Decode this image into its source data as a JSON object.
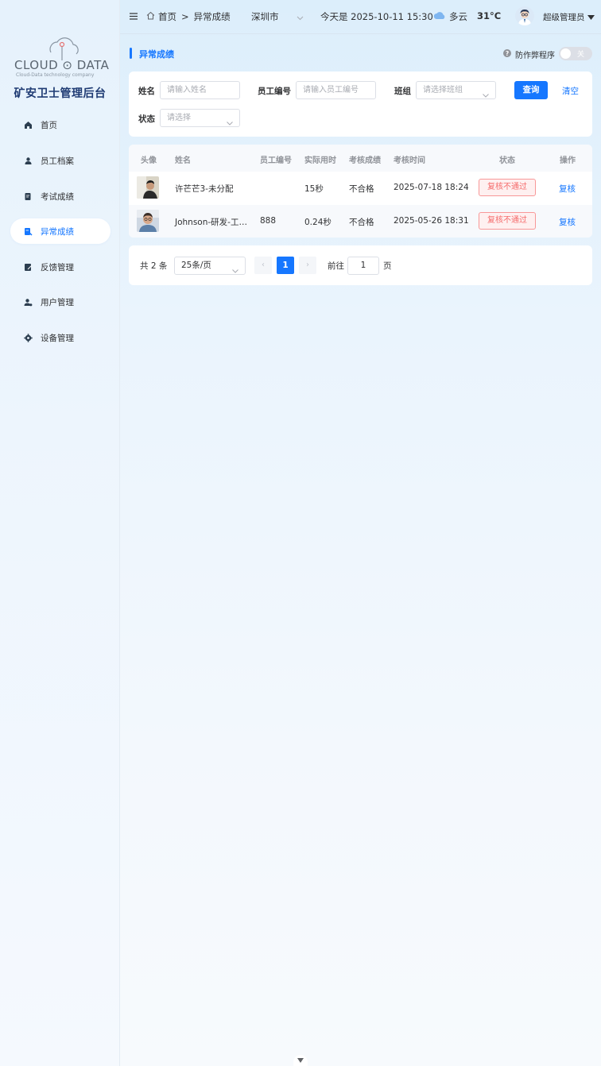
{
  "sidebar": {
    "logo_text": "CLOUD ⊙ DATA",
    "logo_sub": "Cloud-Data technology company",
    "system_title": "矿安卫士管理后台",
    "items": [
      {
        "label": "首页",
        "icon": "home-icon"
      },
      {
        "label": "员工档案",
        "icon": "employee-icon"
      },
      {
        "label": "考试成绩",
        "icon": "exam-icon"
      },
      {
        "label": "异常成绩",
        "icon": "abnormal-icon",
        "active": true
      },
      {
        "label": "反馈管理",
        "icon": "feedback-icon"
      },
      {
        "label": "用户管理",
        "icon": "user-icon"
      },
      {
        "label": "设备管理",
        "icon": "gear-icon"
      }
    ]
  },
  "header": {
    "breadcrumb": [
      "首页",
      "异常成绩"
    ],
    "breadcrumb_sep": ">",
    "city": "深圳市",
    "datetime": "今天是 2025-10-11 15:30",
    "weather": "多云",
    "temperature": "31°C",
    "user": "超级管理员"
  },
  "page": {
    "title": "异常成绩",
    "anti_cheat_label": "防作弊程序",
    "toggle_label": "关"
  },
  "filter": {
    "name_label": "姓名",
    "name_placeholder": "请输入姓名",
    "emp_no_label": "员工编号",
    "emp_no_placeholder": "请输入员工编号",
    "group_label": "班组",
    "group_placeholder": "请选择班组",
    "status_label": "状态",
    "status_placeholder": "请选择",
    "query_button": "查询",
    "clear_button": "清空"
  },
  "table": {
    "columns": [
      "头像",
      "姓名",
      "员工编号",
      "实际用时",
      "考核成绩",
      "考核时间",
      "状态",
      "操作"
    ],
    "rows": [
      {
        "name": "许芒芒3-未分配",
        "emp_no": "",
        "duration": "15秒",
        "result": "不合格",
        "time": "2025-07-18 18:24",
        "status": "复核不通过",
        "action": "复核"
      },
      {
        "name": "Johnson-研发-工…",
        "emp_no": "888",
        "duration": "0.24秒",
        "result": "不合格",
        "time": "2025-05-26 18:31",
        "status": "复核不通过",
        "action": "复核"
      }
    ]
  },
  "pagination": {
    "total": "共 2 条",
    "page_size": "25条/页",
    "prev": "‹",
    "current": "1",
    "next": "›",
    "goto_label": "前往",
    "goto_value": "1",
    "page_unit": "页"
  },
  "colors": {
    "accent": "#1677ff",
    "danger": "#f56c6c"
  }
}
